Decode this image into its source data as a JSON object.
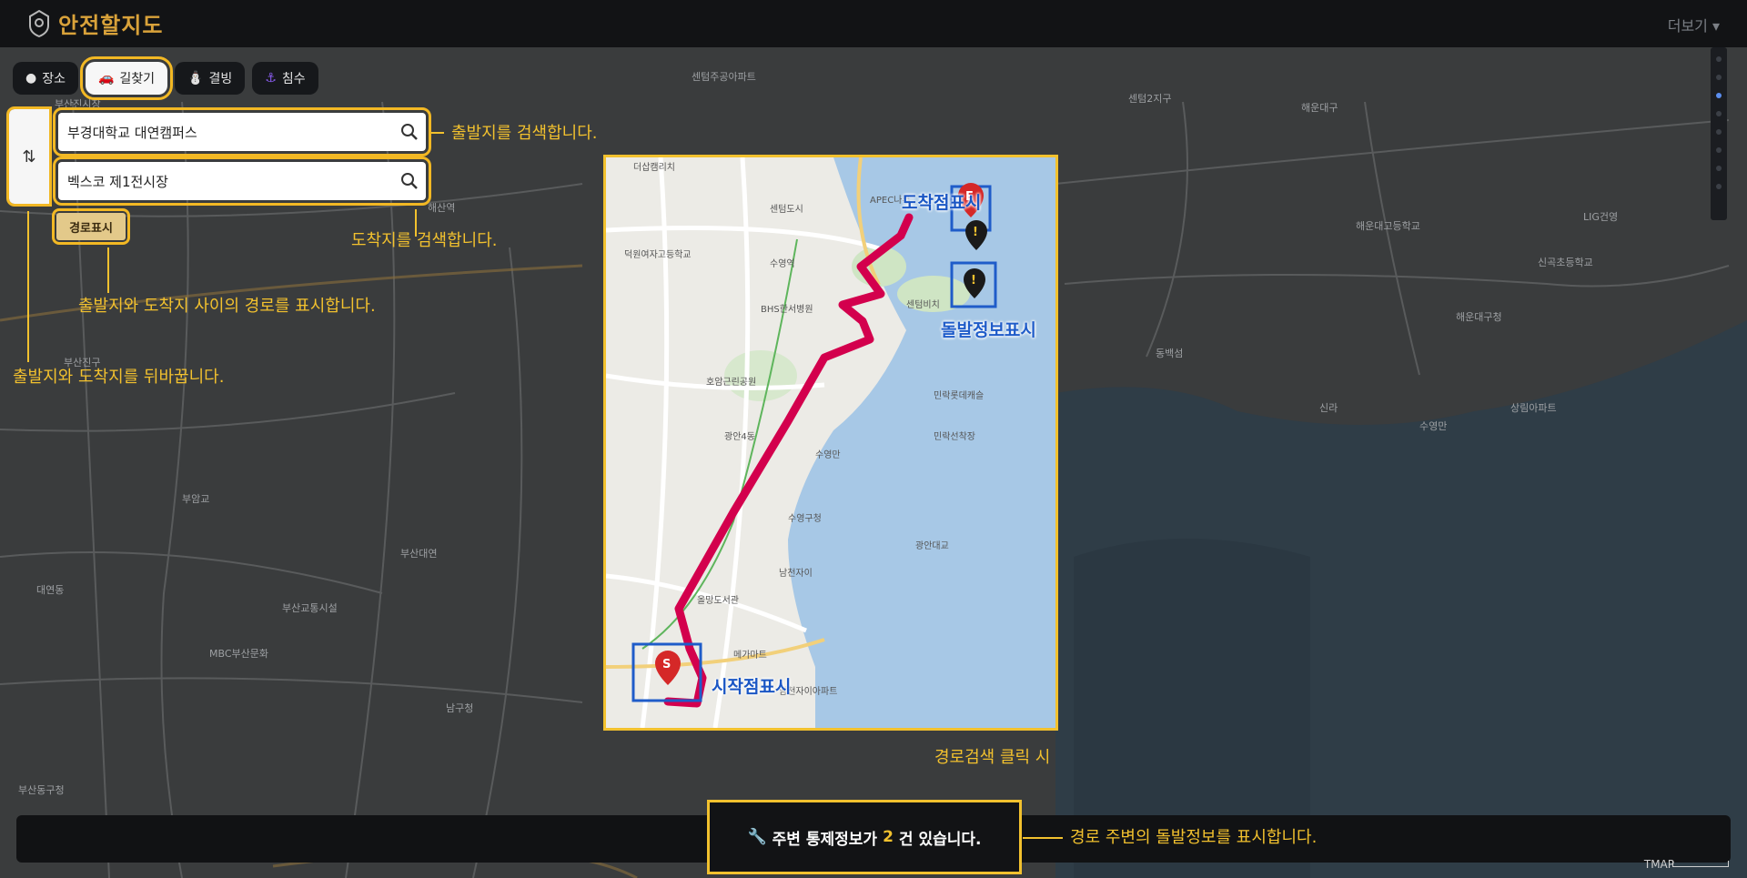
{
  "app": {
    "title": "안전할지도"
  },
  "header": {
    "more_label": "더보기 ▾"
  },
  "tabs": [
    {
      "label": "장소",
      "icon": "search-icon"
    },
    {
      "label": "길찾기",
      "icon": "car-icon",
      "active": true
    },
    {
      "label": "결빙",
      "icon": "ice-icon"
    },
    {
      "label": "침수",
      "icon": "flood-icon"
    }
  ],
  "route": {
    "origin_value": "부경대학교 대연캠퍼스",
    "destination_value": "벡스코 제1전시장",
    "swap_icon": "swap-vertical-icon",
    "search_button_label": "경로표시"
  },
  "annotations": {
    "origin_search": "출발지를 검색합니다.",
    "destination_search": "도착지를 검색합니다.",
    "route_display": "출발지와 도착지 사이의 경로를 표시합니다.",
    "swap": "출발지와 도착지를 뒤바꿉니다.",
    "end_marker": "도착점표시",
    "incident_marker": "돌발정보표시",
    "start_marker": "시작점표시",
    "caption": "경로검색 클릭 시",
    "notice_explain": "경로 주변의 돌발정보를 표시합니다."
  },
  "notice": {
    "prefix": "주변 통제정보가 ",
    "count": "2",
    "suffix": "건 있습니다.",
    "icon": "tools-icon"
  },
  "map_attribution": "TMAP",
  "colors": {
    "accent": "#f2c12e",
    "route": "#d3004d",
    "marker_blue": "#1f5cc9",
    "topbar": "#121315"
  }
}
